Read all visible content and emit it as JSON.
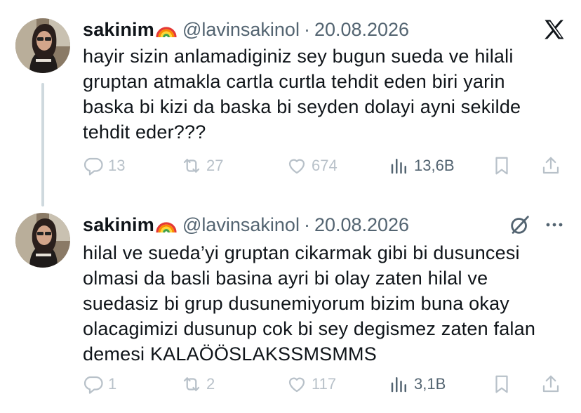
{
  "tweets": [
    {
      "display_name": "sakinim",
      "emoji_icon": "rainbow-emoji",
      "handle": "@lavinsakinol",
      "separator": "·",
      "date": "20.08.2026",
      "lines": [
        "hayir sizin anlamadiginiz sey bugun sueda ve hilali",
        "gruptan atmakla cartla curtla tehdit eden biri yarin",
        "baska bi kizi da baska bi seyden dolayi ayni sekilde",
        "tehdit eder???"
      ],
      "replies": "13",
      "retweets": "27",
      "likes": "674",
      "views": "13,6B"
    },
    {
      "display_name": "sakinim",
      "emoji_icon": "rainbow-emoji",
      "handle": "@lavinsakinol",
      "separator": "·",
      "date": "20.08.2026",
      "lines": [
        "hilal ve sueda’yi gruptan cikarmak gibi bi dusuncesi",
        "olmasi da basli basina ayri bi olay zaten hilal ve",
        "suedasiz bi grup dusunemiyorum bizim buna okay",
        "olacagimizi dusunup cok bi sey degismez zaten falan",
        "demesi KALAÖÖSLAKSSMSMMS"
      ],
      "replies": "1",
      "retweets": "2",
      "likes": "117",
      "views": "3,1B"
    }
  ],
  "icons": [
    "x-logo-icon",
    "grok-icon",
    "more-icon",
    "reply-icon",
    "retweet-icon",
    "like-icon",
    "views-icon",
    "bookmark-icon",
    "share-icon"
  ],
  "colors": {
    "text": "#0f1419",
    "muted": "#536471",
    "faded": "#b8c1c9",
    "thread_line": "#cfd9de"
  }
}
